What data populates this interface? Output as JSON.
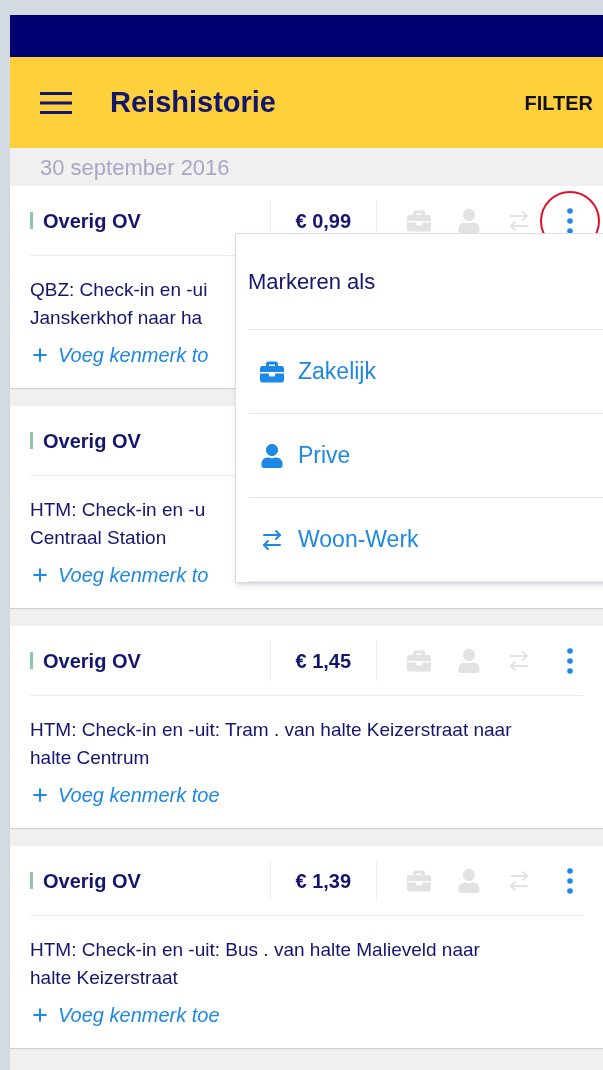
{
  "header": {
    "title": "Reishistorie",
    "action": "FILTER"
  },
  "date": "30 september 2016",
  "cards": [
    {
      "category": "Overig OV",
      "price": "€ 0,99",
      "marks": [
        {
          "kind": "business",
          "selected": false
        },
        {
          "kind": "private",
          "selected": false
        },
        {
          "kind": "commute",
          "selected": false
        }
      ],
      "menu_open": true,
      "description": "QBZ: Check-in en -ui\nJanskerkhof naar ha",
      "add_label": "Voeg kenmerk to"
    },
    {
      "category": "Overig OV",
      "description": "HTM: Check-in en -u\nCentraal Station",
      "add_label": "Voeg kenmerk to"
    },
    {
      "category": "Overig OV",
      "price": "€ 1,45",
      "marks": [
        {
          "kind": "business",
          "selected": false
        },
        {
          "kind": "private",
          "selected": false
        },
        {
          "kind": "commute",
          "selected": false
        }
      ],
      "menu_open": false,
      "description": "HTM: Check-in en -uit: Tram . van halte Keizerstraat naar\nhalte Centrum",
      "add_label": "Voeg kenmerk toe"
    },
    {
      "category": "Overig OV",
      "price": "€ 1,39",
      "marks": [
        {
          "kind": "business",
          "selected": false
        },
        {
          "kind": "private",
          "selected": false
        },
        {
          "kind": "commute",
          "selected": false
        }
      ],
      "menu_open": false,
      "description": "HTM: Check-in en -uit: Bus . van halte Malieveld naar\nhalte Keizerstraat",
      "add_label": "Voeg kenmerk toe"
    }
  ],
  "menu": {
    "title": "Markeren als",
    "items": [
      {
        "kind": "business",
        "label": "Zakelijk"
      },
      {
        "kind": "private",
        "label": "Prive"
      },
      {
        "kind": "commute",
        "label": "Woon-Werk"
      }
    ]
  }
}
